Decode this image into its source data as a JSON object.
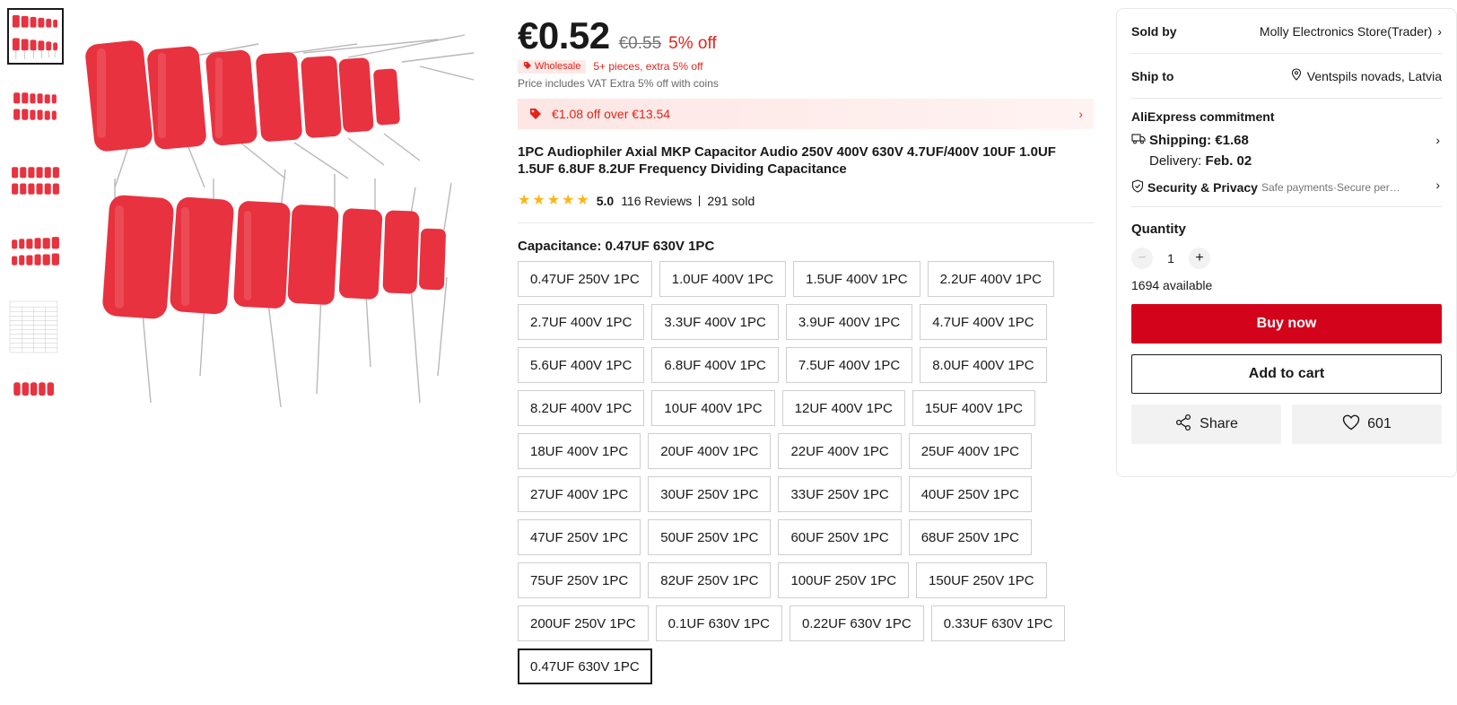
{
  "product": {
    "price": "€0.52",
    "old_price": "€0.55",
    "discount": "5% off",
    "wholesale_badge": "Wholesale",
    "wholesale_text": "5+ pieces, extra 5% off",
    "vat_text": "Price includes VAT Extra 5% off with coins",
    "coupon_text": "€1.08 off over €13.54",
    "title": "1PC Audiophiler Axial MKP Capacitor Audio 250V 400V 630V 4.7UF/400V 10UF 1.0UF 1.5UF 6.8UF 8.2UF Frequency Dividing Capacitance",
    "rating": "5.0",
    "reviews": "116 Reviews",
    "sold": "291 sold",
    "stars": 5
  },
  "variant": {
    "label": "Capacitance: 0.47UF 630V 1PC",
    "options": [
      {
        "label": "0.47UF 250V 1PC"
      },
      {
        "label": "1.0UF 400V 1PC"
      },
      {
        "label": "1.5UF 400V 1PC"
      },
      {
        "label": "2.2UF 400V 1PC"
      },
      {
        "label": "2.7UF 400V 1PC"
      },
      {
        "label": "3.3UF 400V 1PC"
      },
      {
        "label": "3.9UF 400V 1PC"
      },
      {
        "label": "4.7UF 400V 1PC"
      },
      {
        "label": "5.6UF 400V 1PC"
      },
      {
        "label": "6.8UF 400V 1PC"
      },
      {
        "label": "7.5UF 400V 1PC"
      },
      {
        "label": "8.0UF 400V 1PC"
      },
      {
        "label": "8.2UF 400V 1PC"
      },
      {
        "label": "10UF 400V 1PC"
      },
      {
        "label": "12UF 400V 1PC"
      },
      {
        "label": "15UF 400V 1PC"
      },
      {
        "label": "18UF 400V 1PC"
      },
      {
        "label": "20UF 400V 1PC"
      },
      {
        "label": "22UF 400V 1PC"
      },
      {
        "label": "25UF 400V 1PC"
      },
      {
        "label": "27UF 400V 1PC"
      },
      {
        "label": "30UF 250V 1PC"
      },
      {
        "label": "33UF 250V 1PC"
      },
      {
        "label": "40UF 250V 1PC"
      },
      {
        "label": "47UF 250V 1PC"
      },
      {
        "label": "50UF 250V 1PC"
      },
      {
        "label": "60UF 250V 1PC"
      },
      {
        "label": "68UF 250V 1PC"
      },
      {
        "label": "75UF 250V 1PC"
      },
      {
        "label": "82UF 250V 1PC"
      },
      {
        "label": "100UF 250V 1PC"
      },
      {
        "label": "150UF 250V 1PC"
      },
      {
        "label": "200UF 250V 1PC"
      },
      {
        "label": "0.1UF 630V 1PC"
      },
      {
        "label": "0.22UF 630V 1PC"
      },
      {
        "label": "0.33UF 630V 1PC"
      },
      {
        "label": "0.47UF 630V 1PC",
        "selected": true
      }
    ]
  },
  "panel": {
    "sold_by_label": "Sold by",
    "sold_by_value": "Molly Electronics Store(Trader)",
    "ship_to_label": "Ship to",
    "ship_to_value": "Ventspils novads, Latvia",
    "commitment_title": "AliExpress commitment",
    "shipping": "Shipping: €1.68",
    "delivery_label": "Delivery:",
    "delivery_date": "Feb. 02",
    "security_title": "Security & Privacy",
    "security_sub": "Safe payments·Secure personal ...",
    "quantity_label": "Quantity",
    "quantity_value": "1",
    "available": "1694 available",
    "buy_now": "Buy now",
    "add_to_cart": "Add to cart",
    "share": "Share",
    "wishlist_count": "601"
  },
  "colors": {
    "accent_red": "#e1251b",
    "buy_button": "#d3031c",
    "star": "#fdb515",
    "capacitor_body": "#e8323f"
  },
  "icons": [
    "tag-icon",
    "chevron-right-icon",
    "location-pin-icon",
    "truck-icon",
    "shield-check-icon",
    "minus-icon",
    "plus-icon",
    "share-icon",
    "heart-icon",
    "star-icon"
  ]
}
